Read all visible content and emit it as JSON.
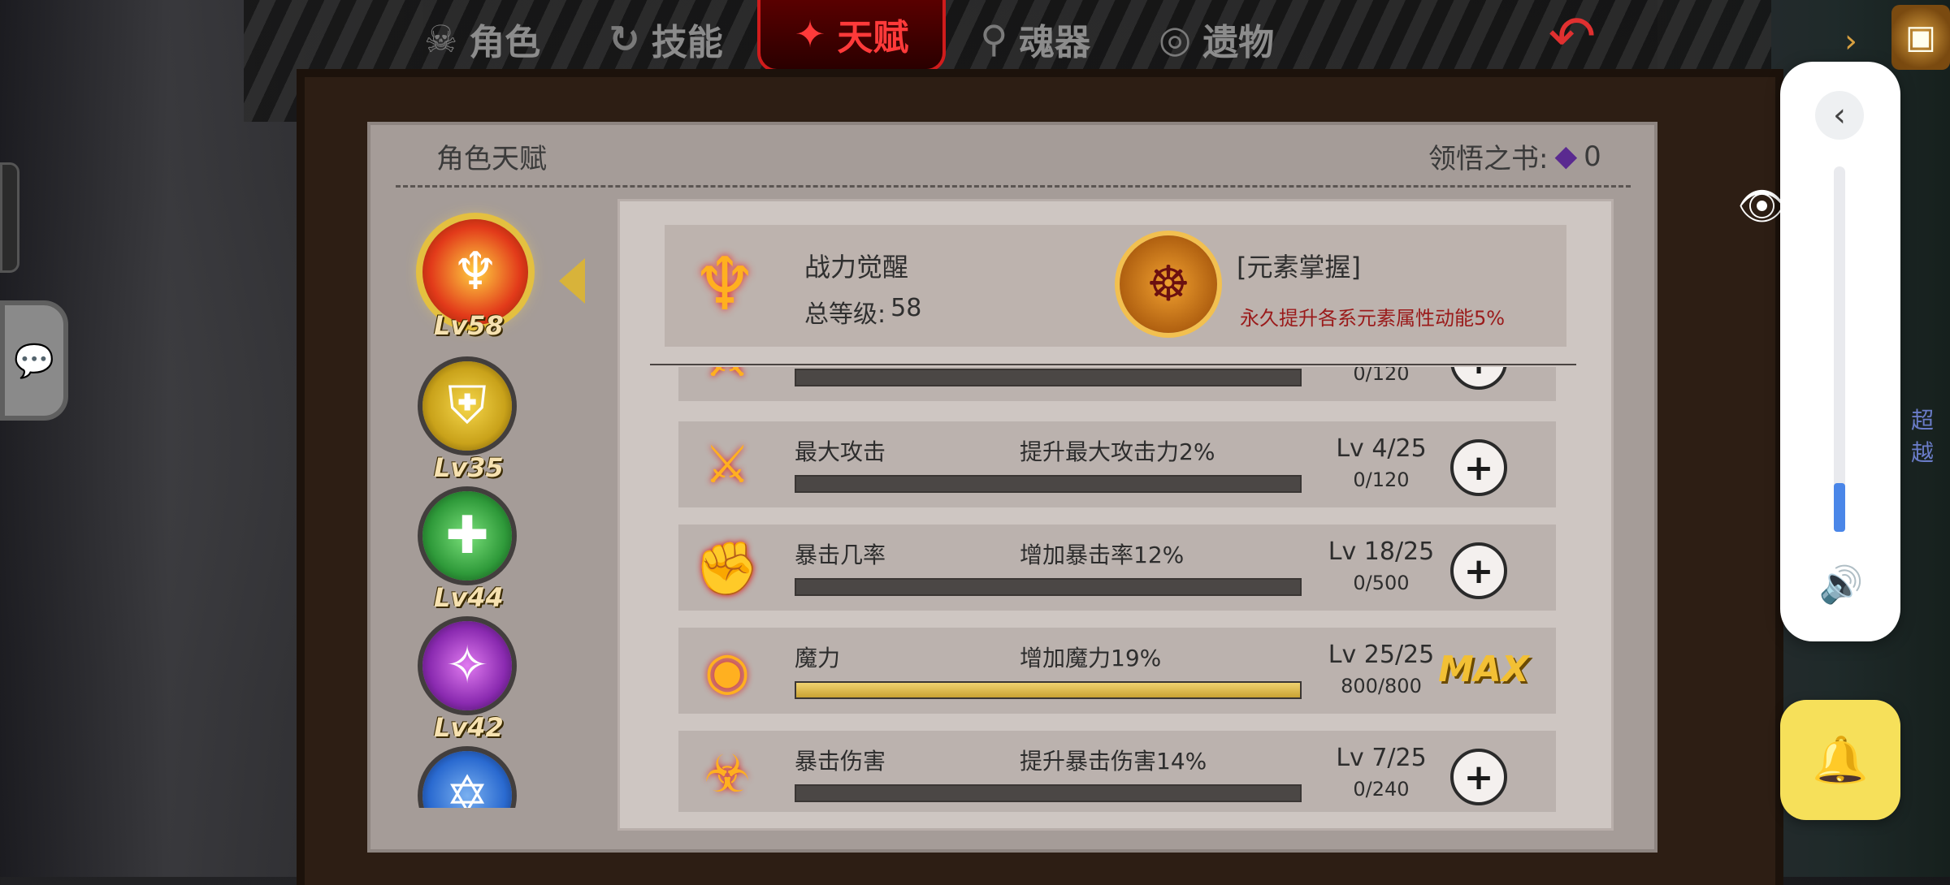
{
  "tabs": [
    {
      "label": "角色",
      "icon": "demon-icon",
      "glyph": "☠"
    },
    {
      "label": "技能",
      "icon": "swirl-icon",
      "glyph": "↻"
    },
    {
      "label": "天赋",
      "icon": "flame-icon",
      "glyph": "✦"
    },
    {
      "label": "魂器",
      "icon": "spirit-icon",
      "glyph": "⚲"
    },
    {
      "label": "遗物",
      "icon": "relic-icon",
      "glyph": "◎"
    }
  ],
  "active_tab": "天赋",
  "panel": {
    "title": "角色天赋",
    "books_label": "领悟之书:",
    "books_count": "0"
  },
  "categories": [
    {
      "level": "Lv58",
      "icon": "sword-flame-icon",
      "color": "#e23a1a",
      "glyph": "♆",
      "selected": true
    },
    {
      "level": "Lv35",
      "icon": "shield-icon",
      "color": "#c9a21a",
      "glyph": "⛨"
    },
    {
      "level": "Lv44",
      "icon": "heal-icon",
      "color": "#2f9a3a",
      "glyph": "✚"
    },
    {
      "level": "Lv42",
      "icon": "magic-star-icon",
      "color": "#8a2ab0",
      "glyph": "✧"
    },
    {
      "level": "",
      "icon": "water-icon",
      "color": "#2a6ad0",
      "glyph": "✡"
    }
  ],
  "awaken": {
    "name": "战力觉醒",
    "level_label": "总等级:",
    "level_value": "58",
    "element_title": "[元素掌握]",
    "element_desc": "永久提升各系元素属性动能5%"
  },
  "rows": [
    {
      "name": "",
      "desc": "",
      "level": "",
      "progress": "0/120",
      "fill": 0,
      "icon": "sword-icon",
      "glyph": "⚔",
      "max": false
    },
    {
      "name": "最大攻击",
      "desc": "提升最大攻击力2%",
      "level": "Lv 4/25",
      "progress": "0/120",
      "fill": 0,
      "icon": "sword-icon",
      "glyph": "⚔",
      "max": false
    },
    {
      "name": "暴击几率",
      "desc": "增加暴击率12%",
      "level": "Lv 18/25",
      "progress": "0/500",
      "fill": 0,
      "icon": "fist-icon",
      "glyph": "✊",
      "max": false
    },
    {
      "name": "魔力",
      "desc": "增加魔力19%",
      "level": "Lv 25/25",
      "progress": "800/800",
      "fill": 1,
      "icon": "spiral-icon",
      "glyph": "◉",
      "max": true
    },
    {
      "name": "暴击伤害",
      "desc": "提升暴击伤害14%",
      "level": "Lv 7/25",
      "progress": "0/240",
      "fill": 0,
      "icon": "demon-icon",
      "glyph": "☣",
      "max": false
    }
  ],
  "max_label": "MAX",
  "side_text": "超越"
}
